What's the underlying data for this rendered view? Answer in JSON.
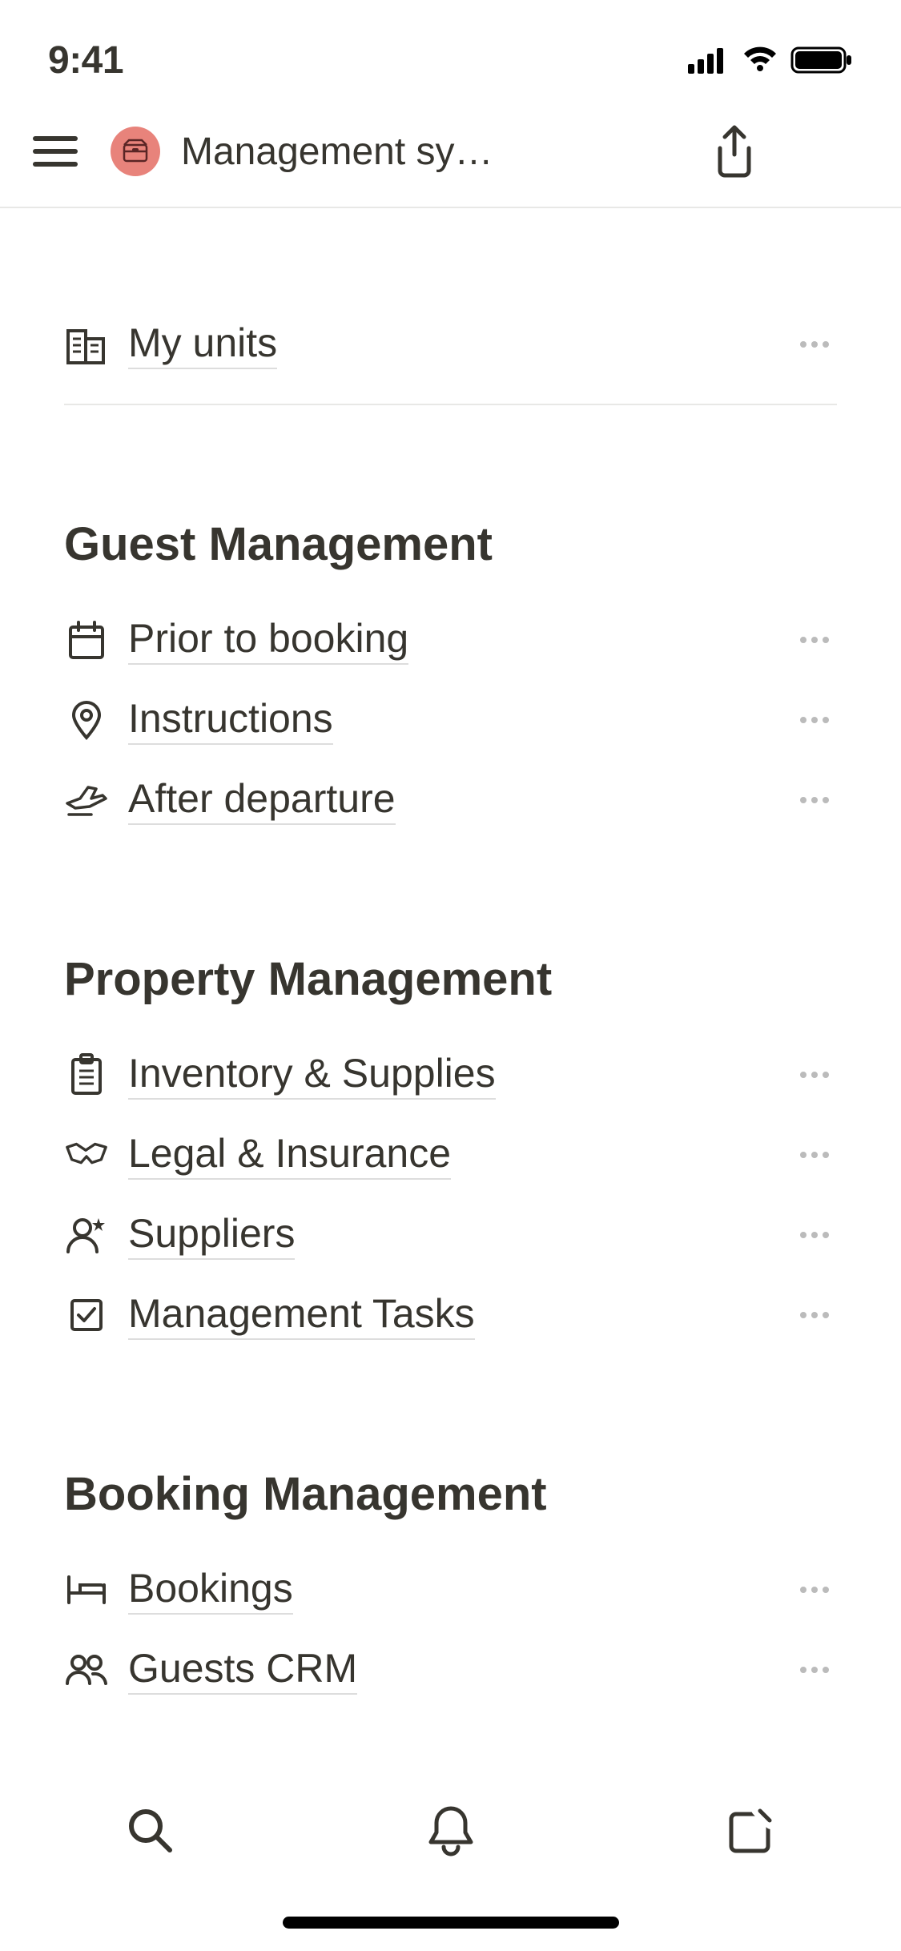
{
  "status": {
    "time": "9:41"
  },
  "header": {
    "title": "Management sy…"
  },
  "top_link": {
    "label": "My units"
  },
  "sections": [
    {
      "heading": "Guest Management",
      "items": [
        {
          "label": "Prior to booking",
          "icon": "calendar-icon"
        },
        {
          "label": "Instructions",
          "icon": "location-icon"
        },
        {
          "label": "After departure",
          "icon": "departure-icon"
        }
      ]
    },
    {
      "heading": "Property Management",
      "items": [
        {
          "label": "Inventory & Supplies",
          "icon": "clipboard-icon"
        },
        {
          "label": "Legal & Insurance",
          "icon": "handshake-icon"
        },
        {
          "label": "Suppliers",
          "icon": "person-star-icon"
        },
        {
          "label": "Management Tasks",
          "icon": "checkbox-icon"
        }
      ]
    },
    {
      "heading": "Booking Management",
      "items": [
        {
          "label": "Bookings",
          "icon": "bed-icon"
        },
        {
          "label": "Guests CRM",
          "icon": "people-icon"
        }
      ]
    }
  ]
}
